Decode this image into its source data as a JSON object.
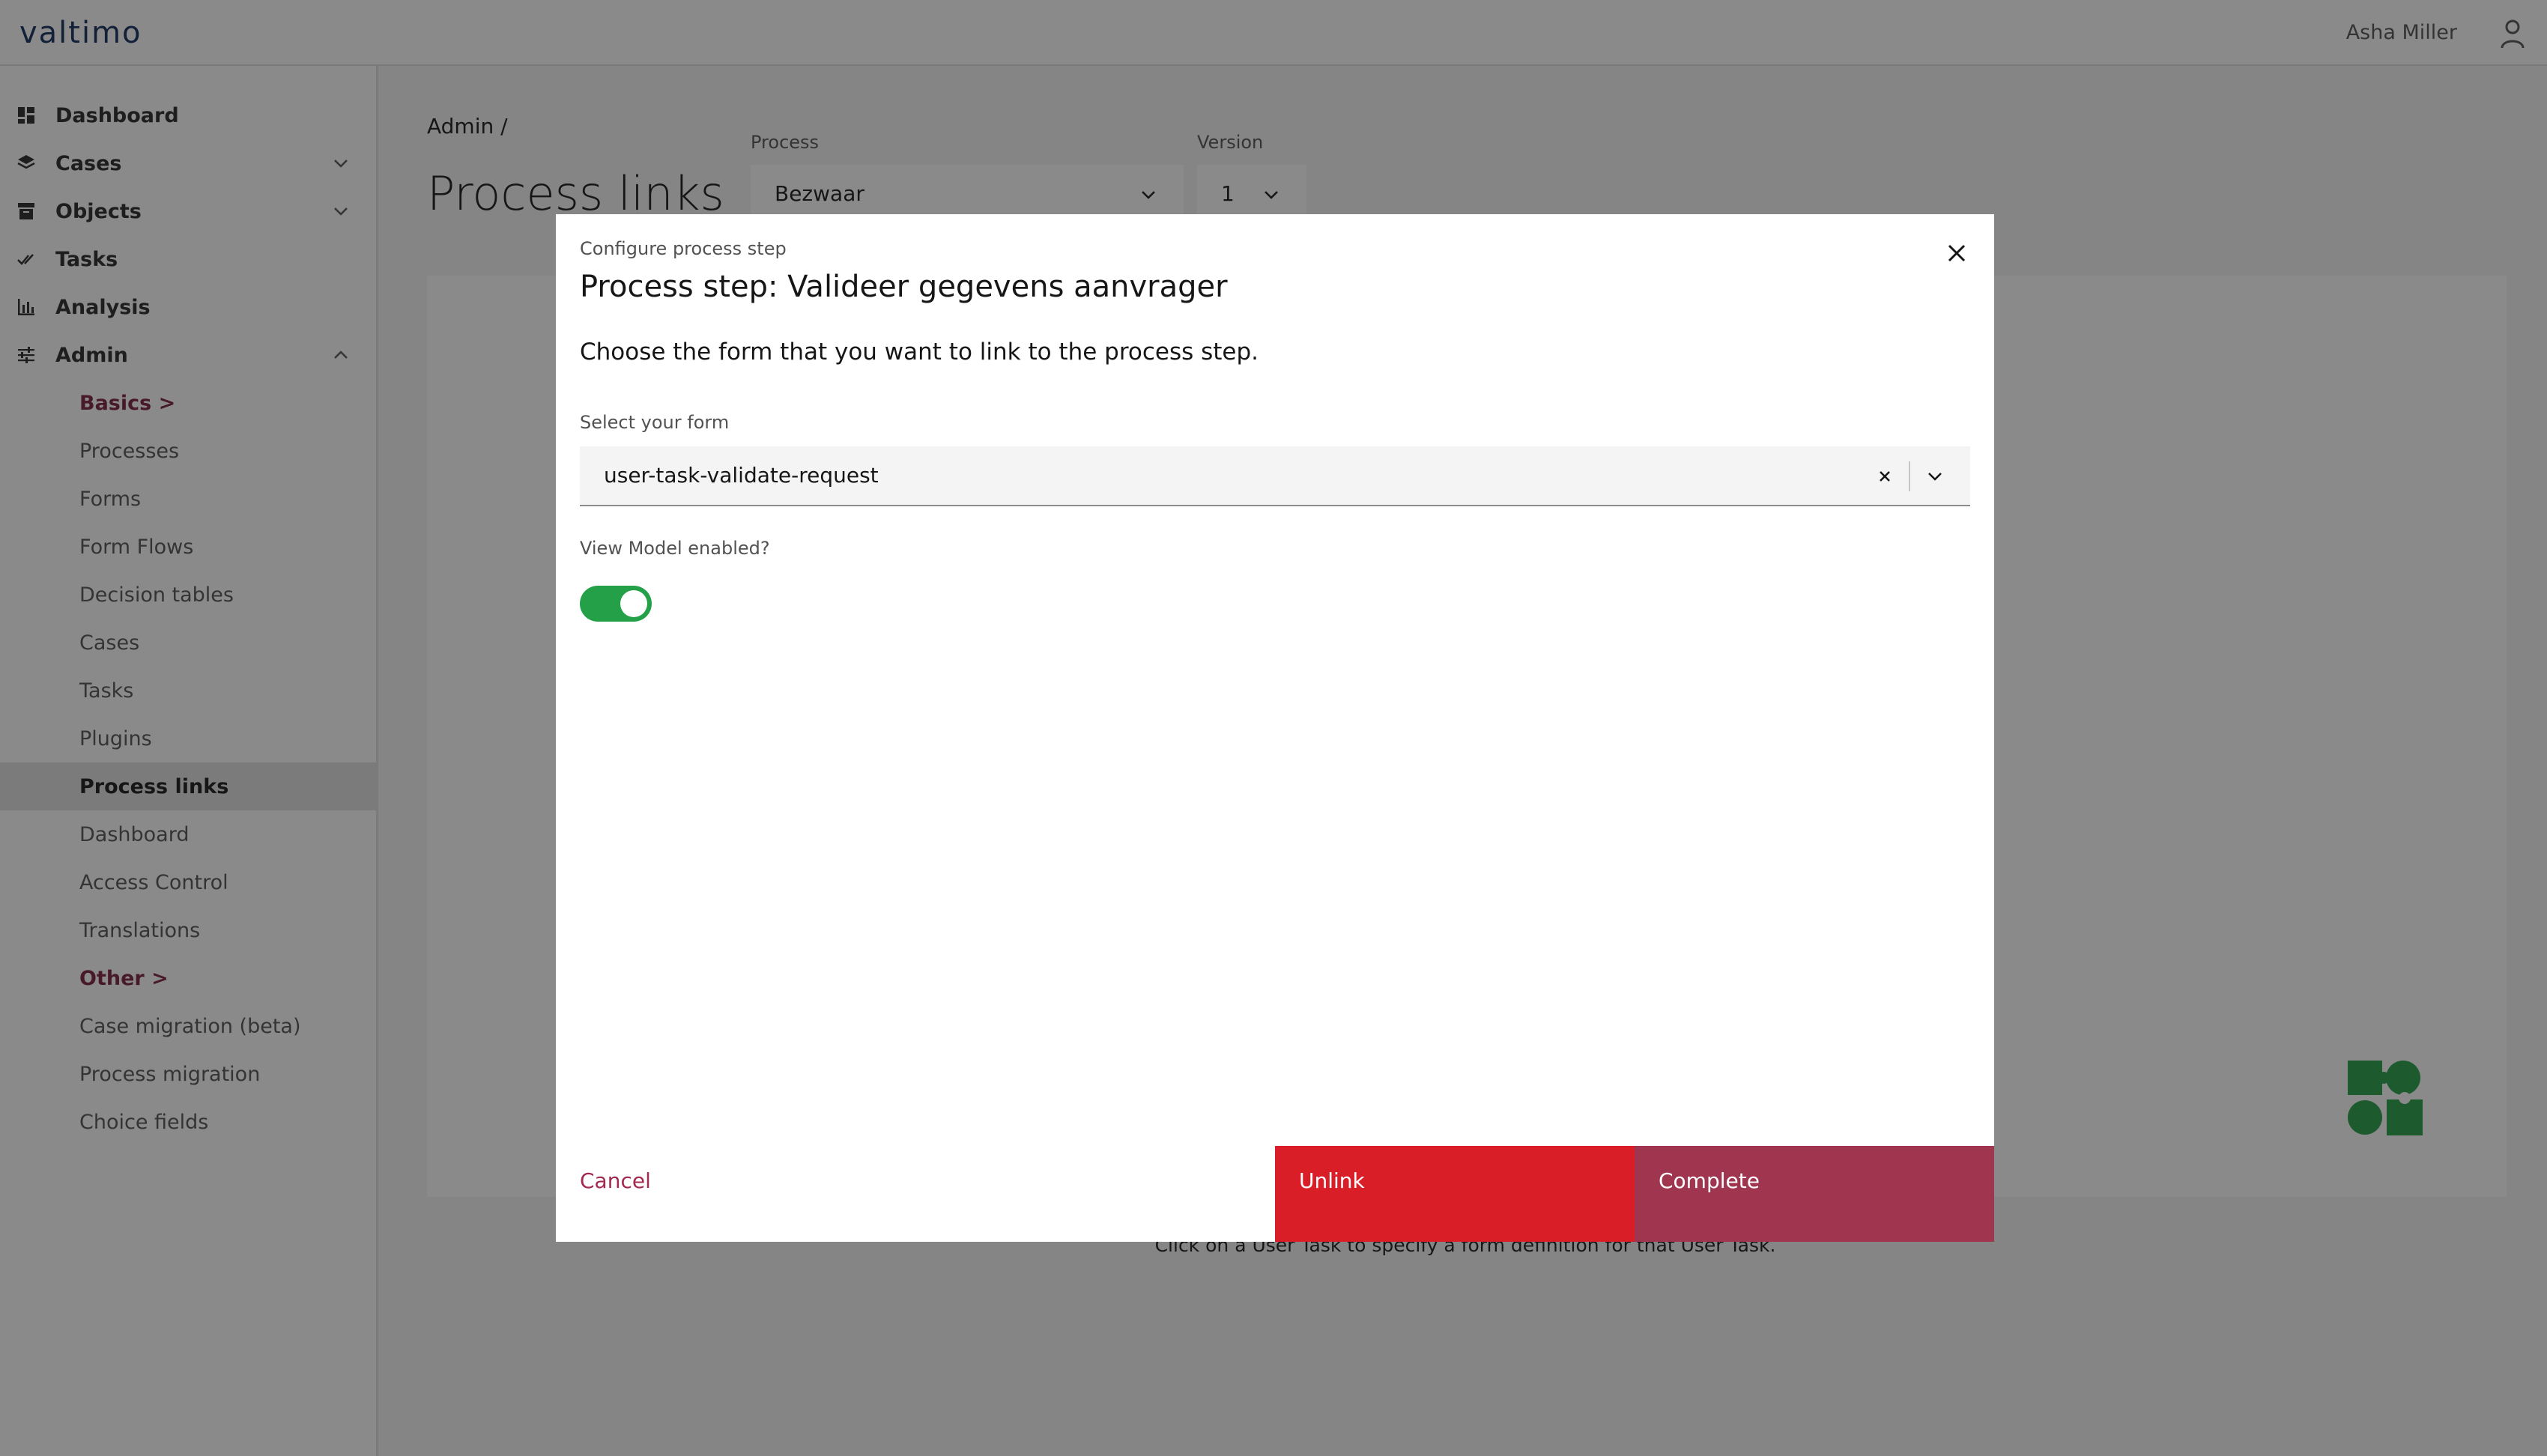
{
  "header": {
    "logo": "valtimo",
    "user_name": "Asha Miller",
    "user_icon": "user-icon"
  },
  "sidebar": {
    "items": [
      {
        "label": "Dashboard",
        "icon": "dashboard-icon",
        "expandable": false
      },
      {
        "label": "Cases",
        "icon": "layers-icon",
        "expandable": true,
        "expanded": false
      },
      {
        "label": "Objects",
        "icon": "archive-icon",
        "expandable": true,
        "expanded": false
      },
      {
        "label": "Tasks",
        "icon": "checkmark-icon",
        "expandable": false
      },
      {
        "label": "Analysis",
        "icon": "bar-chart-icon",
        "expandable": false
      },
      {
        "label": "Admin",
        "icon": "sliders-icon",
        "expandable": true,
        "expanded": true
      }
    ],
    "admin_sub": [
      {
        "label": "Basics >",
        "group": true
      },
      {
        "label": "Processes"
      },
      {
        "label": "Forms"
      },
      {
        "label": "Form Flows"
      },
      {
        "label": "Decision tables"
      },
      {
        "label": "Cases"
      },
      {
        "label": "Tasks"
      },
      {
        "label": "Plugins"
      },
      {
        "label": "Process links",
        "active": true
      },
      {
        "label": "Dashboard"
      },
      {
        "label": "Access Control"
      },
      {
        "label": "Translations"
      },
      {
        "label": "Other >",
        "group": true
      },
      {
        "label": "Case migration (beta)"
      },
      {
        "label": "Process migration"
      },
      {
        "label": "Choice fields"
      }
    ]
  },
  "main": {
    "breadcrumb": "Admin  /",
    "title": "Process links",
    "process_label": "Process",
    "process_value": "Bezwaar",
    "version_label": "Version",
    "version_value": "1",
    "hint": "Click on a User Task to specify a form definition for that User Task."
  },
  "modal": {
    "label": "Configure process step",
    "heading": "Process step: Valideer gegevens aanvrager",
    "description": "Choose the form that you want to link to the process step.",
    "form_field_label": "Select your form",
    "form_value": "user-task-validate-request",
    "toggle_label": "View Model enabled?",
    "toggle_on": true,
    "cancel_label": "Cancel",
    "unlink_label": "Unlink",
    "complete_label": "Complete"
  },
  "colors": {
    "accent": "#a0354f",
    "danger": "#da1e28",
    "toggle_on": "#24a148",
    "puzzle": "#24a148"
  }
}
